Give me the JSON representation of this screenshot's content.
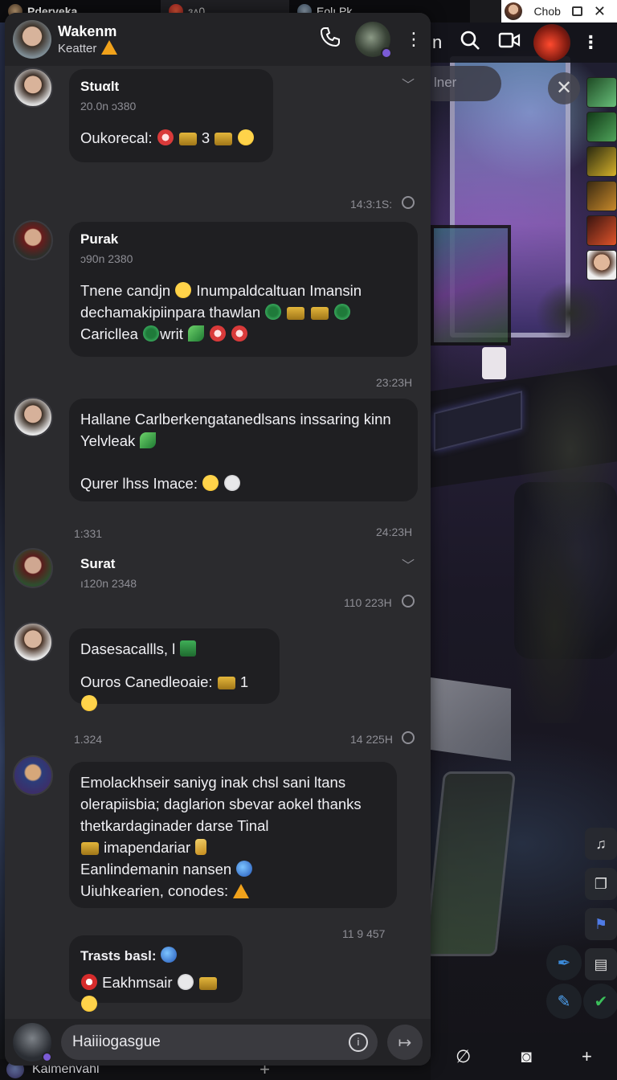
{
  "topbar": {
    "left_title": "Pderveka",
    "mid_label": "ɜᴧ0",
    "mid2_label": "Eolı Pk",
    "right_name": "Chob"
  },
  "right_app": {
    "header_fragment": "n",
    "search_placeholder": "lner"
  },
  "chat": {
    "header": {
      "name": "Wakenm",
      "subtitle": "Keatter"
    },
    "messages": [
      {
        "sender": "Stuαlt",
        "stamp": "20.0n ᴐ380",
        "lines": [
          "Oukorecal:"
        ],
        "suffix": "3",
        "time": "14:3:1S:"
      },
      {
        "sender": "Purak",
        "stamp": "ᴐ90n 2380",
        "lines": [
          "Tnene candjn",
          "Inumpaldcaltuan Imansin",
          "dechamakipiinpara thawlan",
          "Caricllea",
          "writ"
        ],
        "time": "23:23H"
      },
      {
        "sender": "",
        "stamp": "",
        "lines": [
          "Hallane Carlberkengatanedlsans inssaring kinn",
          "Yelvleak",
          "Qurer lhss Imace:"
        ],
        "left_time": "1:331",
        "time": "24:23H"
      },
      {
        "sender": "Surat",
        "stamp": "ı120n 2348",
        "lines": [],
        "time": "110 223H"
      },
      {
        "sender": "",
        "stamp": "",
        "lines": [
          "Dasesacallls, l",
          "Ouros Canedleoaie:"
        ],
        "suffix": "1",
        "left_time": "1.324",
        "time": "14 225H"
      },
      {
        "sender": "",
        "stamp": "",
        "lines": [
          "Emolackhseir saniyg inak chsl sani ltans",
          "olerapiisbia; daglarion sbevar aokel thanks",
          "thetkardaginader darse Tinal",
          "imapendariar",
          "Eanlindemanin nansen",
          "Uiuhkearien, conodes:"
        ],
        "time": "11 9 457"
      },
      {
        "sender": "Trasts basl:",
        "stamp": "",
        "lines": [
          "Eakhmsair"
        ]
      }
    ],
    "composer": {
      "placeholder": "Haiiiogasgue"
    }
  },
  "under_strip": {
    "label": "Kalmenvahl"
  },
  "colors": {
    "panel": "#2b2b2e",
    "bubble": "#1f1f22",
    "accent": "#7b5bd6"
  }
}
